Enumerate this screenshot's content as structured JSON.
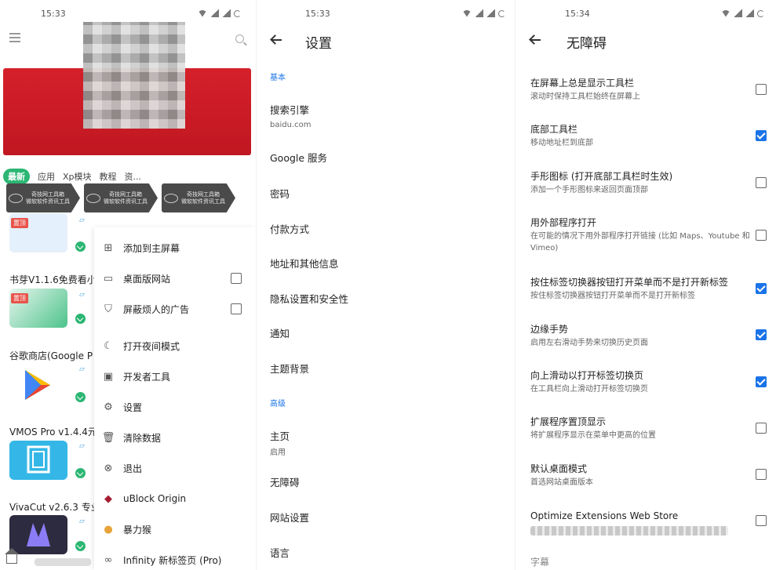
{
  "status": {
    "p1_time": "15:33",
    "p2_time": "15:33",
    "p3_time": "15:34"
  },
  "panel1": {
    "tabs": [
      "最新",
      "应用",
      "Xp模块",
      "教程",
      "资..."
    ],
    "badge_text": "奇技网工具箱\n微软软件资讯工具",
    "top_tag": "置顶",
    "apps": [
      {
        "title": "",
        "color": "#dfeefc"
      },
      {
        "title": "书芽V1.1.6免费看小",
        "color": "#ffffff"
      },
      {
        "title": "谷歌商店(Google P",
        "color": "#ffffff"
      },
      {
        "title": "VMOS Pro v1.4.4元",
        "color": "#2fb7e8"
      },
      {
        "title": "VivaCut v2.6.3 专业",
        "color": "#2b2b3d"
      }
    ],
    "menu": [
      {
        "label": "添加到主屏幕",
        "icon": "add-to-home-icon",
        "glyph": "⊞",
        "checkbox": false
      },
      {
        "label": "桌面版网站",
        "icon": "desktop-icon",
        "glyph": "▭",
        "checkbox": true
      },
      {
        "label": "屏蔽烦人的广告",
        "icon": "shield-icon",
        "glyph": "⛉",
        "checkbox": true
      },
      {
        "label": "打开夜间模式",
        "icon": "moon-icon",
        "glyph": "☾",
        "checkbox": false
      },
      {
        "label": "开发者工具",
        "icon": "terminal-icon",
        "glyph": "▣",
        "checkbox": false
      },
      {
        "label": "设置",
        "icon": "gear-icon",
        "glyph": "⚙",
        "checkbox": false
      },
      {
        "label": "清除数据",
        "icon": "trash-icon",
        "glyph": "🗑",
        "checkbox": false
      },
      {
        "label": "退出",
        "icon": "exit-icon",
        "glyph": "⊗",
        "checkbox": false
      },
      {
        "label": "uBlock Origin",
        "icon": "ublock-icon",
        "glyph": "◆",
        "checkbox": false
      },
      {
        "label": "暴力猴",
        "icon": "violentmonkey-icon",
        "glyph": "●",
        "checkbox": false
      },
      {
        "label": "Infinity 新标签页 (Pro)",
        "icon": "infinity-icon",
        "glyph": "∞",
        "checkbox": false
      }
    ]
  },
  "panel2": {
    "title": "设置",
    "basic_header": "基本",
    "advanced_header": "高级",
    "basic": [
      {
        "title": "搜索引擎",
        "sub": "baidu.com"
      },
      {
        "title": "Google 服务",
        "sub": ""
      },
      {
        "title": "密码",
        "sub": ""
      },
      {
        "title": "付款方式",
        "sub": ""
      },
      {
        "title": "地址和其他信息",
        "sub": ""
      },
      {
        "title": "隐私设置和安全性",
        "sub": ""
      },
      {
        "title": "通知",
        "sub": ""
      },
      {
        "title": "主题背景",
        "sub": ""
      }
    ],
    "advanced": [
      {
        "title": "主页",
        "sub": "启用"
      },
      {
        "title": "无障碍",
        "sub": ""
      },
      {
        "title": "网站设置",
        "sub": ""
      },
      {
        "title": "语言",
        "sub": ""
      }
    ]
  },
  "panel3": {
    "title": "无障碍",
    "items": [
      {
        "title": "在屏幕上总是显示工具栏",
        "sub": "滚动时保持工具栏始终在屏幕上",
        "checked": false
      },
      {
        "title": "底部工具栏",
        "sub": "移动地址栏到底部",
        "checked": true
      },
      {
        "title": "手形图标 (打开底部工具栏时生效)",
        "sub": "添加一个手形图标来返回页面顶部",
        "checked": false
      },
      {
        "title": "用外部程序打开",
        "sub": "在可能的情况下用外部程序打开链接 (比如 Maps、Youtube 和 Vimeo)",
        "checked": false
      },
      {
        "title": "按住标签切换器按钮打开菜单而不是打开新标签",
        "sub": "按住标签切换器按钮打开菜单而不是打开新标签",
        "checked": true
      },
      {
        "title": "边缘手势",
        "sub": "启用左右滑动手势来切换历史页面",
        "checked": true
      },
      {
        "title": "向上滑动以打开标签切换页",
        "sub": "在工具栏向上滑动打开标签切换页",
        "checked": true
      },
      {
        "title": "扩展程序置顶显示",
        "sub": "将扩展程序显示在菜单中更高的位置",
        "checked": false
      },
      {
        "title": "默认桌面模式",
        "sub": "首选网站桌面版本",
        "checked": false
      },
      {
        "title": "Optimize Extensions Web Store",
        "sub": "",
        "checked": false
      }
    ],
    "footer": "字幕"
  },
  "colors": {
    "accent": "#1a73e8",
    "green": "#2bb673",
    "banner_red": "#d5202a"
  }
}
